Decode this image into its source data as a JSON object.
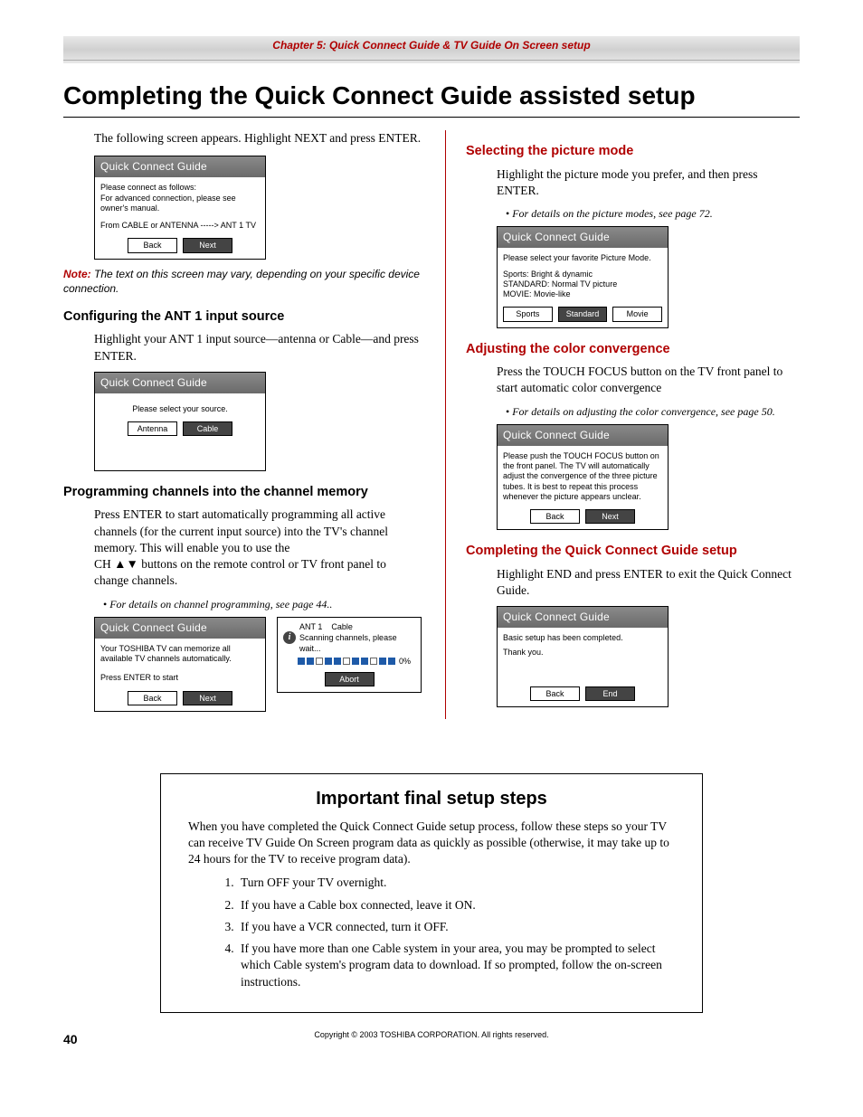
{
  "chapter": "Chapter 5: Quick Connect Guide & TV Guide On Screen setup",
  "title": "Completing the Quick Connect Guide assisted setup",
  "left": {
    "intro": "The following screen appears. Highlight NEXT and press ENTER.",
    "d1": {
      "hdr": "Quick Connect Guide",
      "l1": "Please connect as follows:",
      "l2": "For advanced connection, please see owner's manual.",
      "l3": "From CABLE or ANTENNA -----> ANT 1 TV",
      "back": "Back",
      "next": "Next"
    },
    "noteLabel": "Note:",
    "note": " The text on this screen may vary, depending on your specific device connection.",
    "h2a": "Configuring the ANT 1 input source",
    "p2a": "Highlight your ANT 1 input source—antenna or Cable—and press ENTER.",
    "d2": {
      "hdr": "Quick Connect Guide",
      "l1": "Please select your source.",
      "antenna": "Antenna",
      "cable": "Cable"
    },
    "h2b": "Programming channels into the channel memory",
    "p2b1": "Press ENTER to start automatically programming all active channels (for the current input source) into the TV's channel memory. This will enable you to use the",
    "p2b2": "  buttons on the remote control or TV front panel to change channels.",
    "chLabel": "CH ",
    "bul": "For details on channel programming, see page 44..",
    "d3": {
      "hdr": "Quick Connect Guide",
      "l1": "Your TOSHIBA TV can memorize all available TV channels automatically.",
      "l2": "Press ENTER to start",
      "back": "Back",
      "next": "Next"
    },
    "d3s": {
      "ant": "ANT 1",
      "cable": "Cable",
      "scan": "Scanning channels, please wait...",
      "pct": "0%",
      "abort": "Abort"
    }
  },
  "right": {
    "h1": "Selecting the picture mode",
    "p1": "Highlight the picture mode you prefer, and then press ENTER.",
    "bul1": "For details on the picture modes, see page 72.",
    "d1": {
      "hdr": "Quick Connect Guide",
      "l1": "Please select your favorite Picture Mode.",
      "l2": "Sports: Bright & dynamic",
      "l3": "STANDARD: Normal TV picture",
      "l4": "MOVIE: Movie-like",
      "b1": "Sports",
      "b2": "Standard",
      "b3": "Movie"
    },
    "h2": "Adjusting the color convergence",
    "p2": "Press the TOUCH FOCUS button on the TV front panel to start automatic color convergence",
    "bul2": "For details on adjusting the color convergence, see page 50.",
    "d2": {
      "hdr": "Quick Connect Guide",
      "l1": "Please push the TOUCH FOCUS button on the front panel. The TV will automatically adjust the convergence of the three picture tubes. It is best to repeat this process whenever the picture appears unclear.",
      "back": "Back",
      "next": "Next"
    },
    "h3": "Completing the Quick Connect Guide setup",
    "p3": "Highlight END and press ENTER to exit the Quick Connect Guide.",
    "d3": {
      "hdr": "Quick Connect Guide",
      "l1": "Basic setup has been completed.",
      "l2": "Thank you.",
      "back": "Back",
      "end": "End"
    }
  },
  "final": {
    "title": "Important final setup steps",
    "intro": "When you have completed the Quick Connect Guide setup process, follow these steps so your TV can receive TV Guide On Screen program data as quickly as possible (otherwise, it may take up to 24 hours for the TV to receive program data).",
    "s1": "Turn OFF your TV overnight.",
    "s2": "If you have a Cable box connected, leave it ON.",
    "s3": "If you have a VCR connected, turn it OFF.",
    "s4": "If you have more than one Cable system in your area, you may be prompted to select which Cable system's program data to download. If so prompted, follow the on-screen instructions."
  },
  "footer": "Copyright © 2003 TOSHIBA CORPORATION. All rights reserved.",
  "page": "40"
}
